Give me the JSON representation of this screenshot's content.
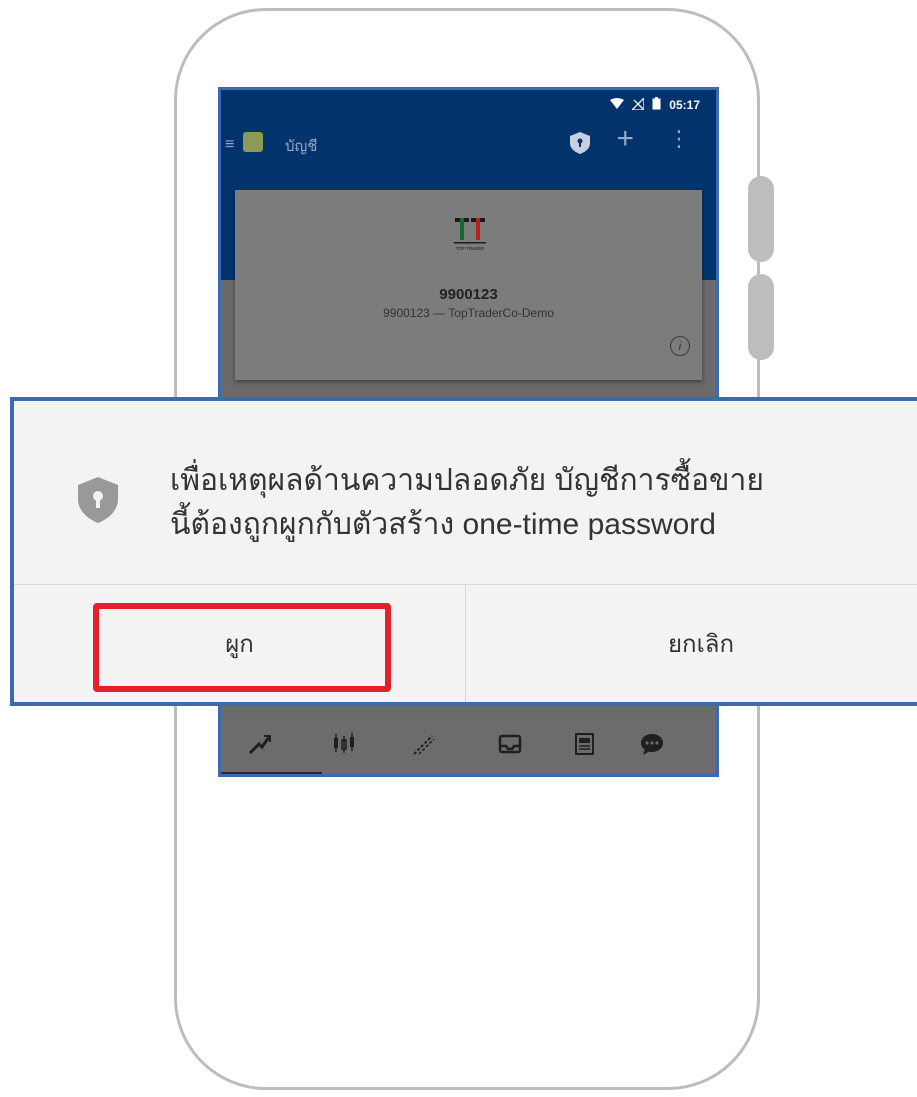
{
  "status_bar": {
    "time": "05:17"
  },
  "app_bar": {
    "title": "บัญชี"
  },
  "account": {
    "logo_text": "TOP TRADER",
    "number": "9900123",
    "description": "9900123 — TopTraderCo-Demo"
  },
  "dialog": {
    "message_line1": "เพื่อเหตุผลด้านความปลอดภัย บัญชีการซื้อขาย",
    "message_line2": "นี้ต้องถูกผูกกับตัวสร้าง one-time password",
    "bind_label": "ผูก",
    "cancel_label": "ยกเลิก"
  },
  "bottom_nav": [
    "trade-icon",
    "chart-icon",
    "history-icon",
    "inbox-icon",
    "news-icon",
    "chat-icon"
  ],
  "colors": {
    "app_bar": "#03336c",
    "frame_border": "#3d69b0",
    "highlight": "#e32129"
  }
}
